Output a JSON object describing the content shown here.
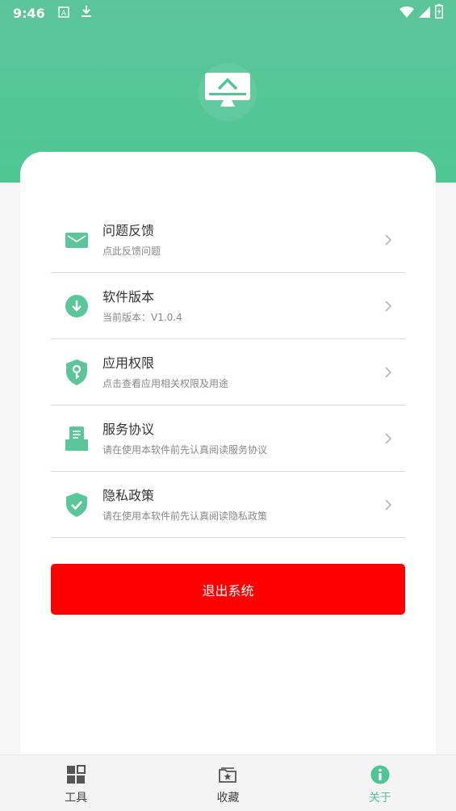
{
  "status_bar": {
    "time": "9:46",
    "left_icons": [
      "font-icon",
      "download-icon"
    ],
    "right_icons": [
      "wifi-icon",
      "signal-icon",
      "battery-icon"
    ]
  },
  "header": {
    "logo_icon": "monitor-icon",
    "bg_color": "#4ec793"
  },
  "menu": {
    "items": [
      {
        "title": "问题反馈",
        "subtitle": "点此反馈问题",
        "icon": "mail-icon"
      },
      {
        "title": "软件版本",
        "subtitle": "当前版本：V1.0.4",
        "icon": "download-circle-icon"
      },
      {
        "title": "应用权限",
        "subtitle": "点击查看应用相关权限及用途",
        "icon": "shield-key-icon"
      },
      {
        "title": "服务协议",
        "subtitle": "请在使用本软件前先认真阅读服务协议",
        "icon": "document-tray-icon"
      },
      {
        "title": "隐私政策",
        "subtitle": "请在使用本软件前先认真阅读隐私政策",
        "icon": "shield-check-icon"
      }
    ]
  },
  "logout": {
    "label": "退出系统",
    "color": "#ff0000"
  },
  "bottom_nav": {
    "items": [
      {
        "label": "工具",
        "icon": "grid-icon",
        "active": false
      },
      {
        "label": "收藏",
        "icon": "star-folder-icon",
        "active": false
      },
      {
        "label": "关于",
        "icon": "info-icon",
        "active": true
      }
    ],
    "active_color": "#4ec793"
  }
}
